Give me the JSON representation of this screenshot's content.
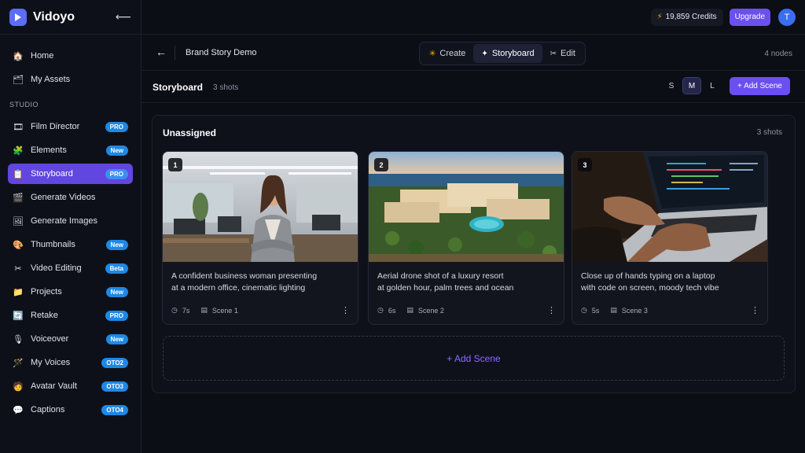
{
  "app": {
    "name": "Vidoyo",
    "collapse_icon": "arrow-left-icon"
  },
  "sidebar": {
    "items_top": [
      {
        "label": "Home",
        "icon": "🏠"
      },
      {
        "label": "My Assets",
        "icon": "🗂"
      }
    ],
    "section_label": "STUDIO",
    "items": [
      {
        "label": "Film Director",
        "icon": "🎞",
        "badge": "PRO"
      },
      {
        "label": "Elements",
        "icon": "🧩",
        "badge": "New"
      },
      {
        "label": "Storyboard",
        "icon": "📋",
        "badge": "PRO",
        "active": true
      },
      {
        "label": "Generate Videos",
        "icon": "🎬",
        "badge": ""
      },
      {
        "label": "Generate Images",
        "icon": "🖼",
        "badge": ""
      },
      {
        "label": "Thumbnails",
        "icon": "🎨",
        "badge": "New"
      },
      {
        "label": "Video Editing",
        "icon": "✂",
        "badge": "Beta"
      },
      {
        "label": "Projects",
        "icon": "📁",
        "badge": "New"
      },
      {
        "label": "Retake",
        "icon": "🔄",
        "badge": "PRO"
      },
      {
        "label": "Voiceover",
        "icon": "🎙",
        "badge": "New"
      },
      {
        "label": "My Voices",
        "icon": "🪄",
        "badge": "OTO2"
      },
      {
        "label": "Avatar Vault",
        "icon": "🧑",
        "badge": "OTO3"
      },
      {
        "label": "Captions",
        "icon": "💬",
        "badge": "OTO4"
      }
    ]
  },
  "topbar": {
    "credits": "19,859 Credits",
    "upgrade": "Upgrade",
    "avatar_initial": "T"
  },
  "project": {
    "title": "Brand Story Demo",
    "tabs": [
      {
        "label": "Create",
        "icon": "✳"
      },
      {
        "label": "Storyboard",
        "icon": "✦",
        "active": true
      },
      {
        "label": "Edit",
        "icon": "✂"
      }
    ],
    "nodes": "4 nodes"
  },
  "storyboard": {
    "title": "Storyboard",
    "count": "3 shots",
    "sizes": [
      "S",
      "M",
      "L"
    ],
    "active_size": "M",
    "add_scene": "+ Add Scene"
  },
  "group": {
    "title": "Unassigned",
    "count": "3 shots",
    "add_scene": "+ Add Scene",
    "cards": [
      {
        "number": "1",
        "desc_line1": "A confident business woman presenting",
        "desc_line2": "at a modern office, cinematic lighting",
        "duration": "7s",
        "scene": "Scene 1"
      },
      {
        "number": "2",
        "desc_line1": "Aerial drone shot of a luxury resort",
        "desc_line2": "at golden hour, palm trees and ocean",
        "duration": "6s",
        "scene": "Scene 2"
      },
      {
        "number": "3",
        "desc_line1": "Close up of hands typing on a laptop",
        "desc_line2": "with code on screen, moody tech vibe",
        "duration": "5s",
        "scene": "Scene 3"
      }
    ]
  }
}
